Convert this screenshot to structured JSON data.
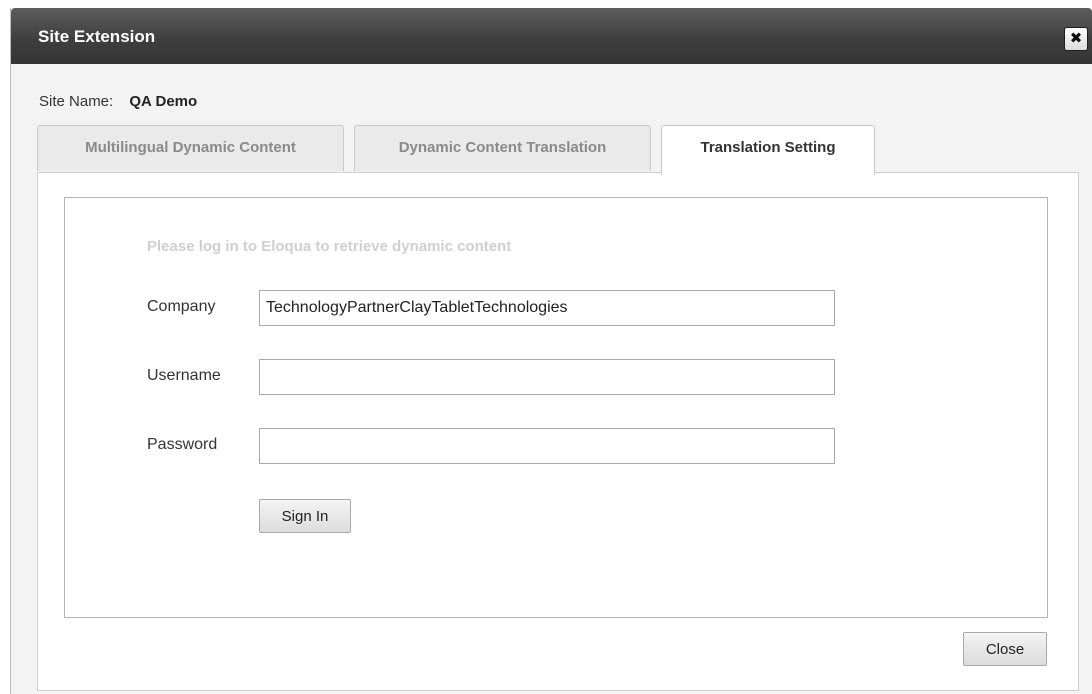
{
  "dialog": {
    "title": "Site Extension",
    "close_glyph": "✖",
    "close_icon": "close-icon"
  },
  "site": {
    "label": "Site Name:",
    "value": "QA Demo"
  },
  "tabs": [
    {
      "label": "Multilingual Dynamic Content",
      "active": false
    },
    {
      "label": "Dynamic Content Translation",
      "active": false
    },
    {
      "label": "Translation Setting",
      "active": true
    }
  ],
  "login": {
    "hint": "Please log in to Eloqua to retrieve dynamic content",
    "company_label": "Company",
    "company_value": "TechnologyPartnerClayTabletTechnologies",
    "username_label": "Username",
    "username_value": "",
    "password_label": "Password",
    "password_value": "",
    "sign_in_label": "Sign In"
  },
  "footer": {
    "close_label": "Close"
  }
}
